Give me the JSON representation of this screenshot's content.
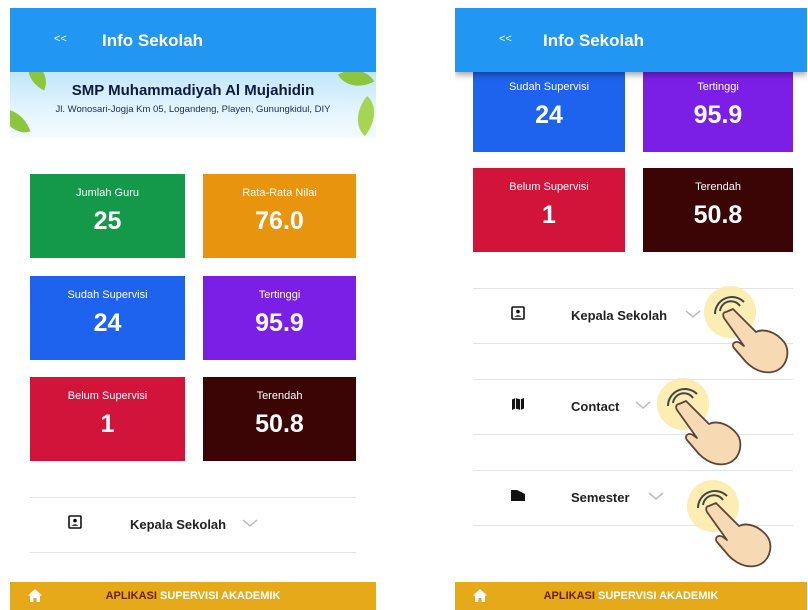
{
  "left": {
    "back_label": "<<",
    "title": "Info Sekolah",
    "school_name": "SMP Muhammadiyah Al Mujahidin",
    "school_address": "Jl. Wonosari-Jogja Km 05, Logandeng, Playen, Gunungkidul, DIY",
    "cards": [
      {
        "label": "Jumlah Guru",
        "value": "25",
        "color": "#14984a"
      },
      {
        "label": "Rata-Rata Nilai",
        "value": "76.0",
        "color": "#e8940e"
      },
      {
        "label": "Sudah Supervisi",
        "value": "24",
        "color": "#1e63ee"
      },
      {
        "label": "Tertinggi",
        "value": "95.9",
        "color": "#7b1fe7"
      },
      {
        "label": "Belum Supervisi",
        "value": "1",
        "color": "#d2143a"
      },
      {
        "label": "Terendah",
        "value": "50.8",
        "color": "#3c0505"
      }
    ],
    "rows": [
      {
        "label": "Kepala Sekolah",
        "icon": "person-badge-icon"
      }
    ]
  },
  "right": {
    "back_label": "<<",
    "title": "Info Sekolah",
    "cards": [
      {
        "label": "Sudah Supervisi",
        "value": "24",
        "color": "#1e63ee"
      },
      {
        "label": "Tertinggi",
        "value": "95.9",
        "color": "#7b1fe7"
      },
      {
        "label": "Belum Supervisi",
        "value": "1",
        "color": "#d2143a"
      },
      {
        "label": "Terendah",
        "value": "50.8",
        "color": "#3c0505"
      }
    ],
    "rows": [
      {
        "label": "Kepala Sekolah",
        "icon": "person-badge-icon"
      },
      {
        "label": "Contact",
        "icon": "map-icon"
      },
      {
        "label": "Semester",
        "icon": "folder-icon"
      }
    ]
  },
  "footer": {
    "part1": "APLIKASI",
    "part2": "SUPERVISI AKADEMIK",
    "icon": "home-icon"
  },
  "colors": {
    "appbar": "#2196f3",
    "footer": "#e6a919"
  }
}
